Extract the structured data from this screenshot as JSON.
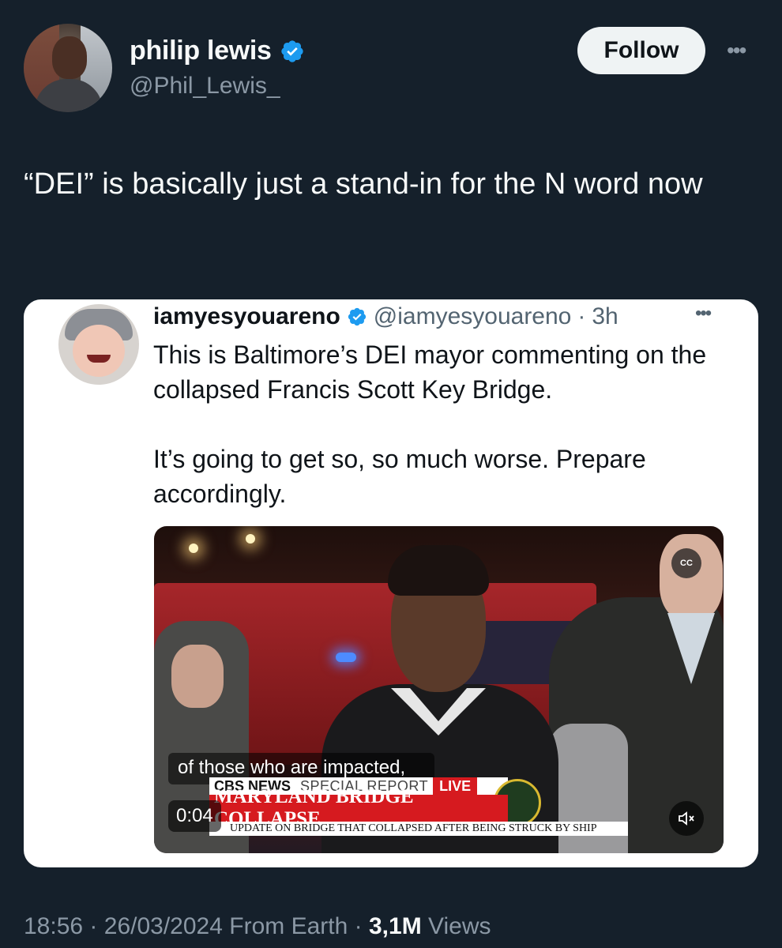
{
  "author": {
    "display_name": "philip lewis",
    "handle": "@Phil_Lewis_",
    "verified": true
  },
  "follow_label": "Follow",
  "more_label": "•••",
  "tweet_text": "“DEI” is basically just a stand-in for the N word now",
  "quoted": {
    "display_name": "iamyesyouareno",
    "handle": "@iamyesyouareno",
    "separator": "·",
    "time": "3h",
    "more_label": "•••",
    "paragraph1": "This is Baltimore’s DEI mayor commenting on the collapsed Francis Scott Key Bridge.",
    "paragraph2": "It’s going to get so, so much worse. Prepare accordingly.",
    "video": {
      "cc_label": "CC",
      "caption": "of those who are impacted,",
      "network": "CBS NEWS",
      "report_label": "SPECIAL REPORT",
      "live_label": "LIVE",
      "headline": "MARYLAND BRIDGE COLLAPSE",
      "ticker": "UPDATE ON BRIDGE THAT COLLAPSED AFTER BEING STRUCK BY SHIP",
      "time": "0:04"
    }
  },
  "meta": {
    "time": "18:56",
    "sep1": "·",
    "date": "26/03/2024",
    "source": "From Earth",
    "sep2": "·",
    "views_count": "3,1M",
    "views_label": "Views"
  },
  "colors": {
    "background": "#15202b",
    "verified_blue": "#1d9bf0",
    "muted_text": "#8b98a5",
    "cbs_red": "#d61a1f"
  }
}
